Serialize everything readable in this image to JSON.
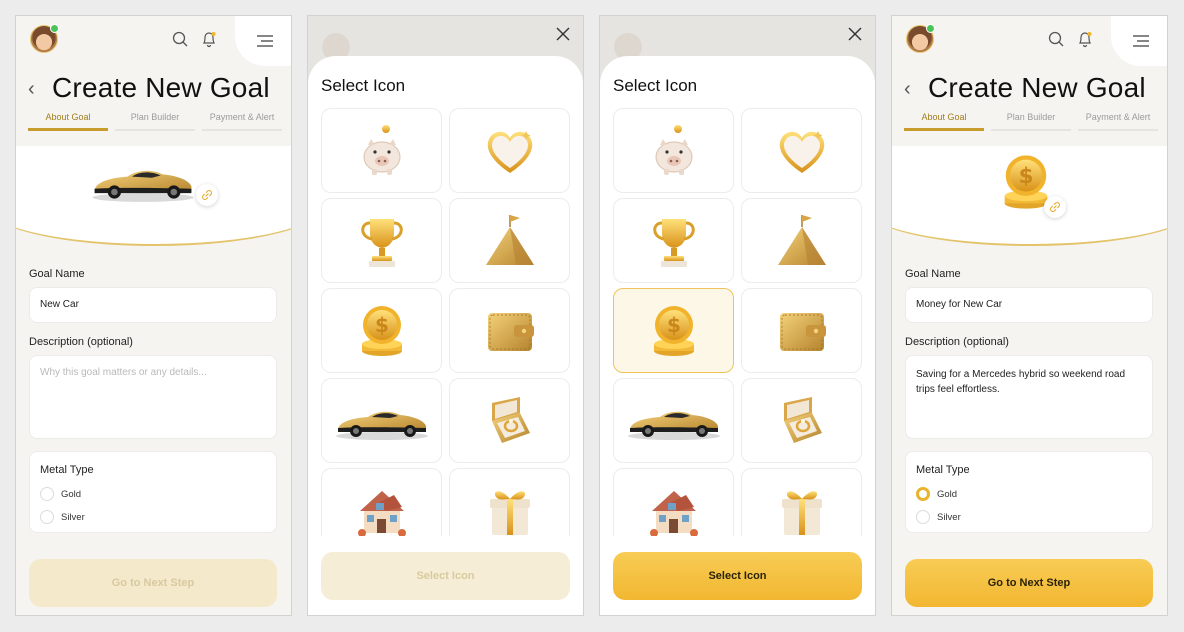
{
  "screens": {
    "form_empty": {
      "title": "Create New Goal",
      "tabs": [
        "About Goal",
        "Plan Builder",
        "Payment & Alert"
      ],
      "goal_name_label": "Goal Name",
      "goal_name_value": "New Car",
      "description_label": "Description (optional)",
      "description_placeholder": "Why this goal matters or any details...",
      "metal_type_label": "Metal Type",
      "metal_options": [
        "Gold",
        "Silver"
      ],
      "selected_metal": "",
      "cta_label": "Go to  Next Step",
      "hero_icon": "car-icon"
    },
    "select_icon_disabled": {
      "title": "Select Icon",
      "cta_label": "Select Icon",
      "icons": [
        "piggy-bank-icon",
        "heart-icon",
        "trophy-icon",
        "mountain-flag-icon",
        "coin-icon",
        "wallet-icon",
        "car-icon",
        "ring-box-icon",
        "house-icon",
        "gift-icon"
      ],
      "selected_icon": ""
    },
    "select_icon_enabled": {
      "title": "Select Icon",
      "cta_label": "Select Icon",
      "icons": [
        "piggy-bank-icon",
        "heart-icon",
        "trophy-icon",
        "mountain-flag-icon",
        "coin-icon",
        "wallet-icon",
        "car-icon",
        "ring-box-icon",
        "house-icon",
        "gift-icon"
      ],
      "selected_icon": "coin-icon"
    },
    "form_filled": {
      "title": "Create New Goal",
      "tabs": [
        "About Goal",
        "Plan Builder",
        "Payment & Alert"
      ],
      "goal_name_label": "Goal Name",
      "goal_name_value": "Money for New Car",
      "description_label": "Description (optional)",
      "description_value": "Saving for a Mercedes hybrid so weekend road trips feel effortless.",
      "metal_type_label": "Metal Type",
      "metal_options": [
        "Gold",
        "Silver"
      ],
      "selected_metal": "Gold",
      "cta_label": "Go to  Next Step",
      "hero_icon": "coin-icon"
    }
  },
  "colors": {
    "accent_gold": "#f2b731",
    "tab_active": "#c79b2c",
    "background": "#f5f4f1",
    "disabled_cta": "#f4e9cb"
  }
}
